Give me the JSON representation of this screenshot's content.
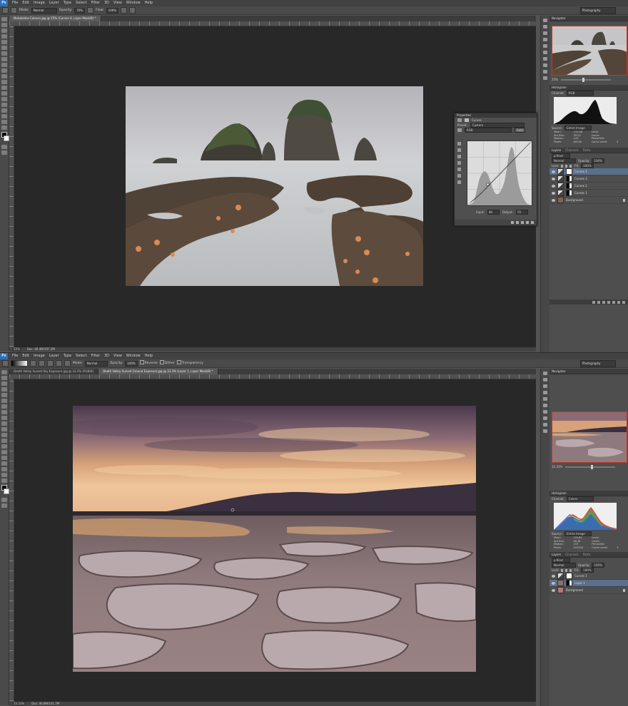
{
  "colors": {
    "ps_blue": "#2f6fb5",
    "selection_blue": "#5a6f8c",
    "nav_border": "#c0392b"
  },
  "menu": [
    "File",
    "Edit",
    "Image",
    "Layer",
    "Type",
    "Select",
    "Filter",
    "3D",
    "View",
    "Window",
    "Help"
  ],
  "app_logo": "Ps",
  "window1": {
    "options": {
      "mode_label": "Mode:",
      "mode_value": "Normal",
      "opacity_label": "Opacity:",
      "opacity_value": "70%",
      "flow_label": "Flow:",
      "flow_value": "100%"
    },
    "workspace": "Photography",
    "tab": "Motukiekie Colours.jpg @ 25% (Curves 4, Layer Mask/8) *",
    "status": {
      "zoom": "25%",
      "doc": "Doc: 46.4M/197.2M"
    },
    "properties": {
      "title": "Properties",
      "panel_name": "Curves",
      "preset_label": "Preset:",
      "preset_value": "Custom",
      "channel_value": "RGB",
      "auto_label": "Auto",
      "input_label": "Input:",
      "input_value": "48",
      "output_label": "Output:",
      "output_value": "55"
    },
    "navigator_title": "Navigator",
    "nav_zoom": "25%",
    "histogram": {
      "title": "Histogram",
      "channel_label": "Channel:",
      "channel_value": "RGB",
      "source_label": "Source:",
      "source_value": "Entire Image",
      "stats": [
        [
          "Mean:",
          "112.48",
          "Level:",
          ""
        ],
        [
          "Std Dev:",
          "59.02",
          "Count:",
          ""
        ],
        [
          "Median:",
          "120",
          "Percentile:",
          ""
        ],
        [
          "Pixels:",
          "64746",
          "Cache Level:",
          "4"
        ]
      ]
    },
    "layers": {
      "tabs": [
        "Layers",
        "Channels",
        "Paths"
      ],
      "kind": "ρ Kind",
      "blend": "Normal",
      "opacity_label": "Opacity:",
      "opacity_value": "100%",
      "lock_label": "Lock:",
      "fill_label": "Fill:",
      "fill_value": "100%",
      "items": [
        {
          "name": "Curves 4",
          "selected": true,
          "type": "adjustment"
        },
        {
          "name": "Curves 3",
          "selected": false,
          "type": "adjustment"
        },
        {
          "name": "Curves 2",
          "selected": false,
          "type": "adjustment"
        },
        {
          "name": "Curves 1",
          "selected": false,
          "type": "adjustment"
        },
        {
          "name": "Background",
          "selected": false,
          "type": "background"
        }
      ]
    }
  },
  "window2": {
    "options": {
      "mode_label": "Mode:",
      "mode_value": "Normal",
      "opacity_label": "Opacity:",
      "opacity_value": "100%",
      "reverse_label": "Reverse",
      "dither_label": "Dither",
      "transparency_label": "Transparency"
    },
    "workspace": "Photography",
    "tabs": [
      "Death Valley Sunset Sky Exposure.jpg @ 33.3% (RGB/8)",
      "Death Valley Sunset Ground Exposure.jpg @ 33.3% (Layer 1, Layer Mask/8) *"
    ],
    "status": {
      "zoom": "33.33%",
      "doc": "Doc: 46.8M/101.7M"
    },
    "navigator_title": "Navigator",
    "nav_zoom": "33.33%",
    "histogram": {
      "title": "Histogram",
      "channel_label": "Channel:",
      "channel_value": "Colors",
      "source_label": "Source:",
      "source_value": "Entire Image",
      "stats": [
        [
          "Mean:",
          "125.85",
          "Level:",
          ""
        ],
        [
          "Std Dev:",
          "46.38",
          "Count:",
          ""
        ],
        [
          "Median:",
          "133",
          "Percentile:",
          ""
        ],
        [
          "Pixels:",
          "203328",
          "Cache Level:",
          "3"
        ]
      ]
    },
    "layers": {
      "tabs": [
        "Layers",
        "Channels",
        "Paths"
      ],
      "kind": "ρ Kind",
      "blend": "Normal",
      "opacity_label": "Opacity:",
      "opacity_value": "100%",
      "lock_label": "Lock:",
      "fill_label": "Fill:",
      "fill_value": "100%",
      "items": [
        {
          "name": "Curves 1",
          "selected": false,
          "type": "adjustment"
        },
        {
          "name": "Layer 1",
          "selected": true,
          "type": "pixel"
        },
        {
          "name": "Background",
          "selected": false,
          "type": "background"
        }
      ]
    }
  }
}
